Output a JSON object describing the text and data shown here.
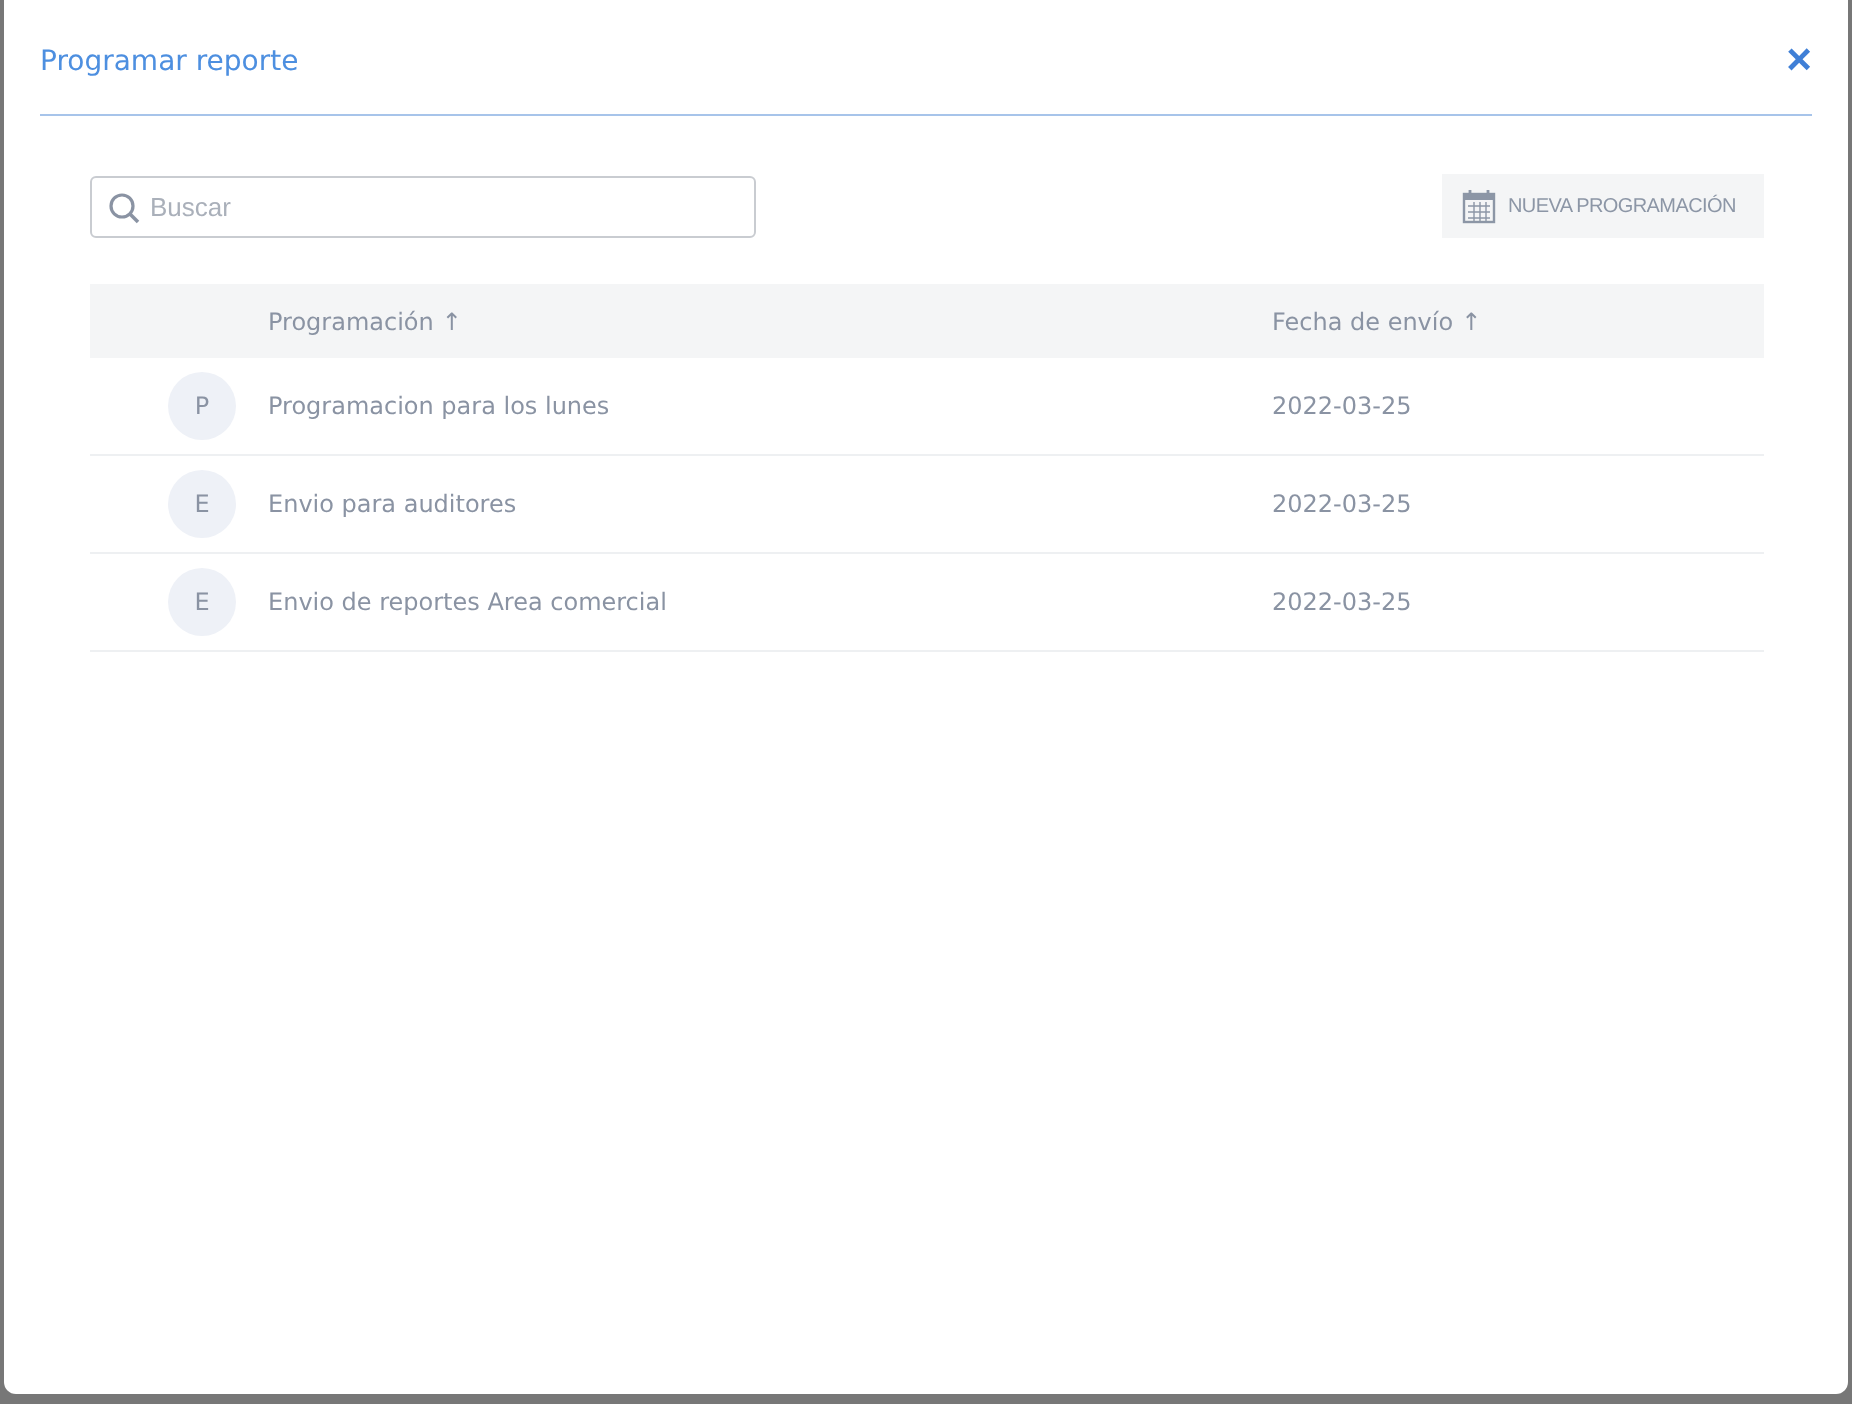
{
  "dialog": {
    "title": "Programar reporte",
    "close": "×"
  },
  "search": {
    "placeholder": "Buscar"
  },
  "new_button": {
    "label": "NUEVA PROGRAMACIÓN"
  },
  "table": {
    "columns": [
      {
        "label": "Programación",
        "sort": "↑"
      },
      {
        "label": "Fecha de envío",
        "sort": "↑"
      }
    ],
    "rows": [
      {
        "initial": "P",
        "name": "Programacion para los lunes",
        "date": "2022-03-25"
      },
      {
        "initial": "E",
        "name": "Envio para auditores",
        "date": "2022-03-25"
      },
      {
        "initial": "E",
        "name": "Envio de reportes Area comercial",
        "date": "2022-03-25"
      }
    ]
  }
}
